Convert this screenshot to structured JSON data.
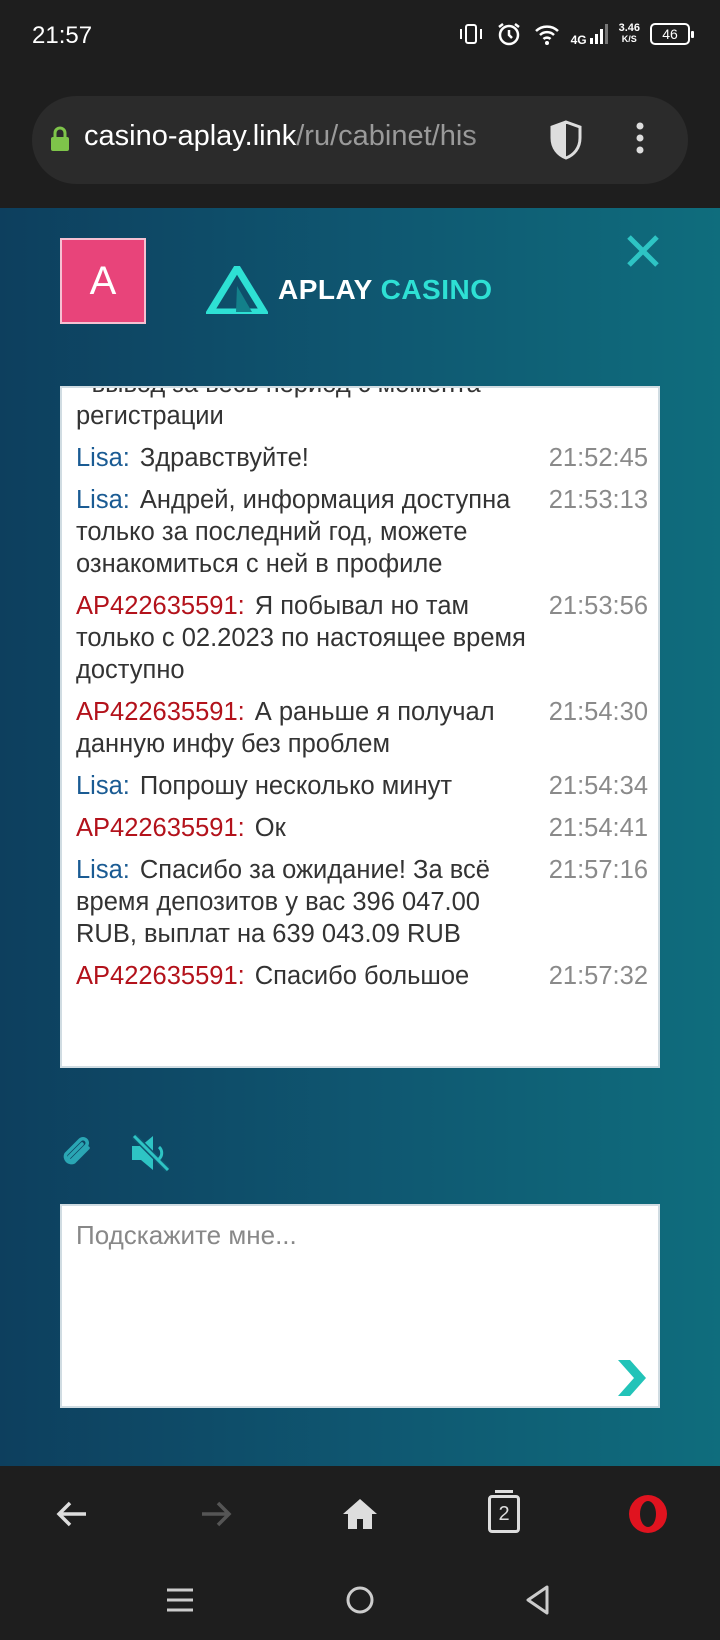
{
  "status_bar": {
    "time": "21:57",
    "net_speed_value": "3.46",
    "net_speed_unit": "K/S",
    "signal_label": "4G",
    "battery": "46"
  },
  "browser": {
    "url_host": "casino-aplay.link",
    "url_path": "/ru/cabinet/his",
    "tabs_count": "2"
  },
  "header": {
    "avatar_letter": "A",
    "logo_word1": "APLAY",
    "logo_word2": "CASINO",
    "accent_color": "#2ee0d4"
  },
  "chat": {
    "messages": [
      {
        "sender": "",
        "text": "- вывод за весь период с момента регистрации",
        "time": ""
      },
      {
        "sender": "Lisa:",
        "text": "Здравствуйте!",
        "time": "21:52:45"
      },
      {
        "sender": "Lisa:",
        "text": "Андрей, информация доступна только за последний год, можете ознакомиться с ней в профиле",
        "time": "21:53:13"
      },
      {
        "sender": "AP422635591:",
        "text": "Я побывал но там только с 02.2023 по настоящее время доступно",
        "time": "21:53:56"
      },
      {
        "sender": "AP422635591:",
        "text": "А раньше я получал данную инфу без проблем",
        "time": "21:54:30"
      },
      {
        "sender": "Lisa:",
        "text": "Попрошу несколько минут",
        "time": "21:54:34"
      },
      {
        "sender": "AP422635591:",
        "text": "Ок",
        "time": "21:54:41"
      },
      {
        "sender": "Lisa:",
        "text": "Спасибо за ожидание! За всё время депозитов у вас 396 047.00 RUB, выплат на 639 043.09 RUB",
        "time": "21:57:16"
      },
      {
        "sender": "AP422635591:",
        "text": "Спасибо большое",
        "time": "21:57:32"
      }
    ],
    "input_placeholder": "Подскажите мне..."
  }
}
